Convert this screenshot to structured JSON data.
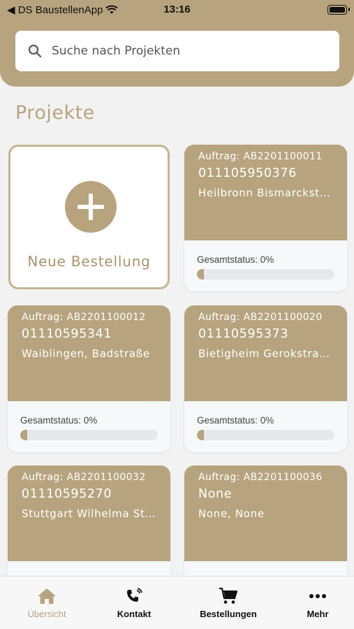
{
  "status_bar": {
    "carrier": "◀ DS BaustellenApp",
    "time": "13:16"
  },
  "search": {
    "placeholder": "Suche nach Projekten"
  },
  "section_title": "Projekte",
  "new_order": {
    "label": "Neue Bestellung"
  },
  "projects": [
    {
      "auftrag": "Auftrag: AB2201100011",
      "number": "011105950376",
      "location": "Heilbronn Bismarckstraße",
      "status_label": "Gesamtstatus: 0%",
      "status": 0
    },
    {
      "auftrag": "Auftrag: AB2201100012",
      "number": "01110595341",
      "location": "Waiblingen, Badstraße",
      "status_label": "Gesamtstatus: 0%",
      "status": 0
    },
    {
      "auftrag": "Auftrag: AB2201100020",
      "number": "01110595373",
      "location": "Bietigheim Gerokstraße",
      "status_label": "Gesamtstatus: 0%",
      "status": 0
    },
    {
      "auftrag": "Auftrag: AB2201100032",
      "number": "01110595270",
      "location": "Stuttgart Wilhelma Straße",
      "status_label": "",
      "status": 0
    },
    {
      "auftrag": "Auftrag: AB2201100036",
      "number": "None",
      "location": "None, None",
      "status_label": "",
      "status": 0
    }
  ],
  "tabs": [
    {
      "label": "Übersicht",
      "icon": "home-icon",
      "active": true
    },
    {
      "label": "Kontakt",
      "icon": "phone-icon",
      "active": false
    },
    {
      "label": "Bestellungen",
      "icon": "cart-icon",
      "active": false
    },
    {
      "label": "Mehr",
      "icon": "more-icon",
      "active": false
    }
  ],
  "colors": {
    "accent": "#b7a47e",
    "background": "#f2f2f2"
  }
}
